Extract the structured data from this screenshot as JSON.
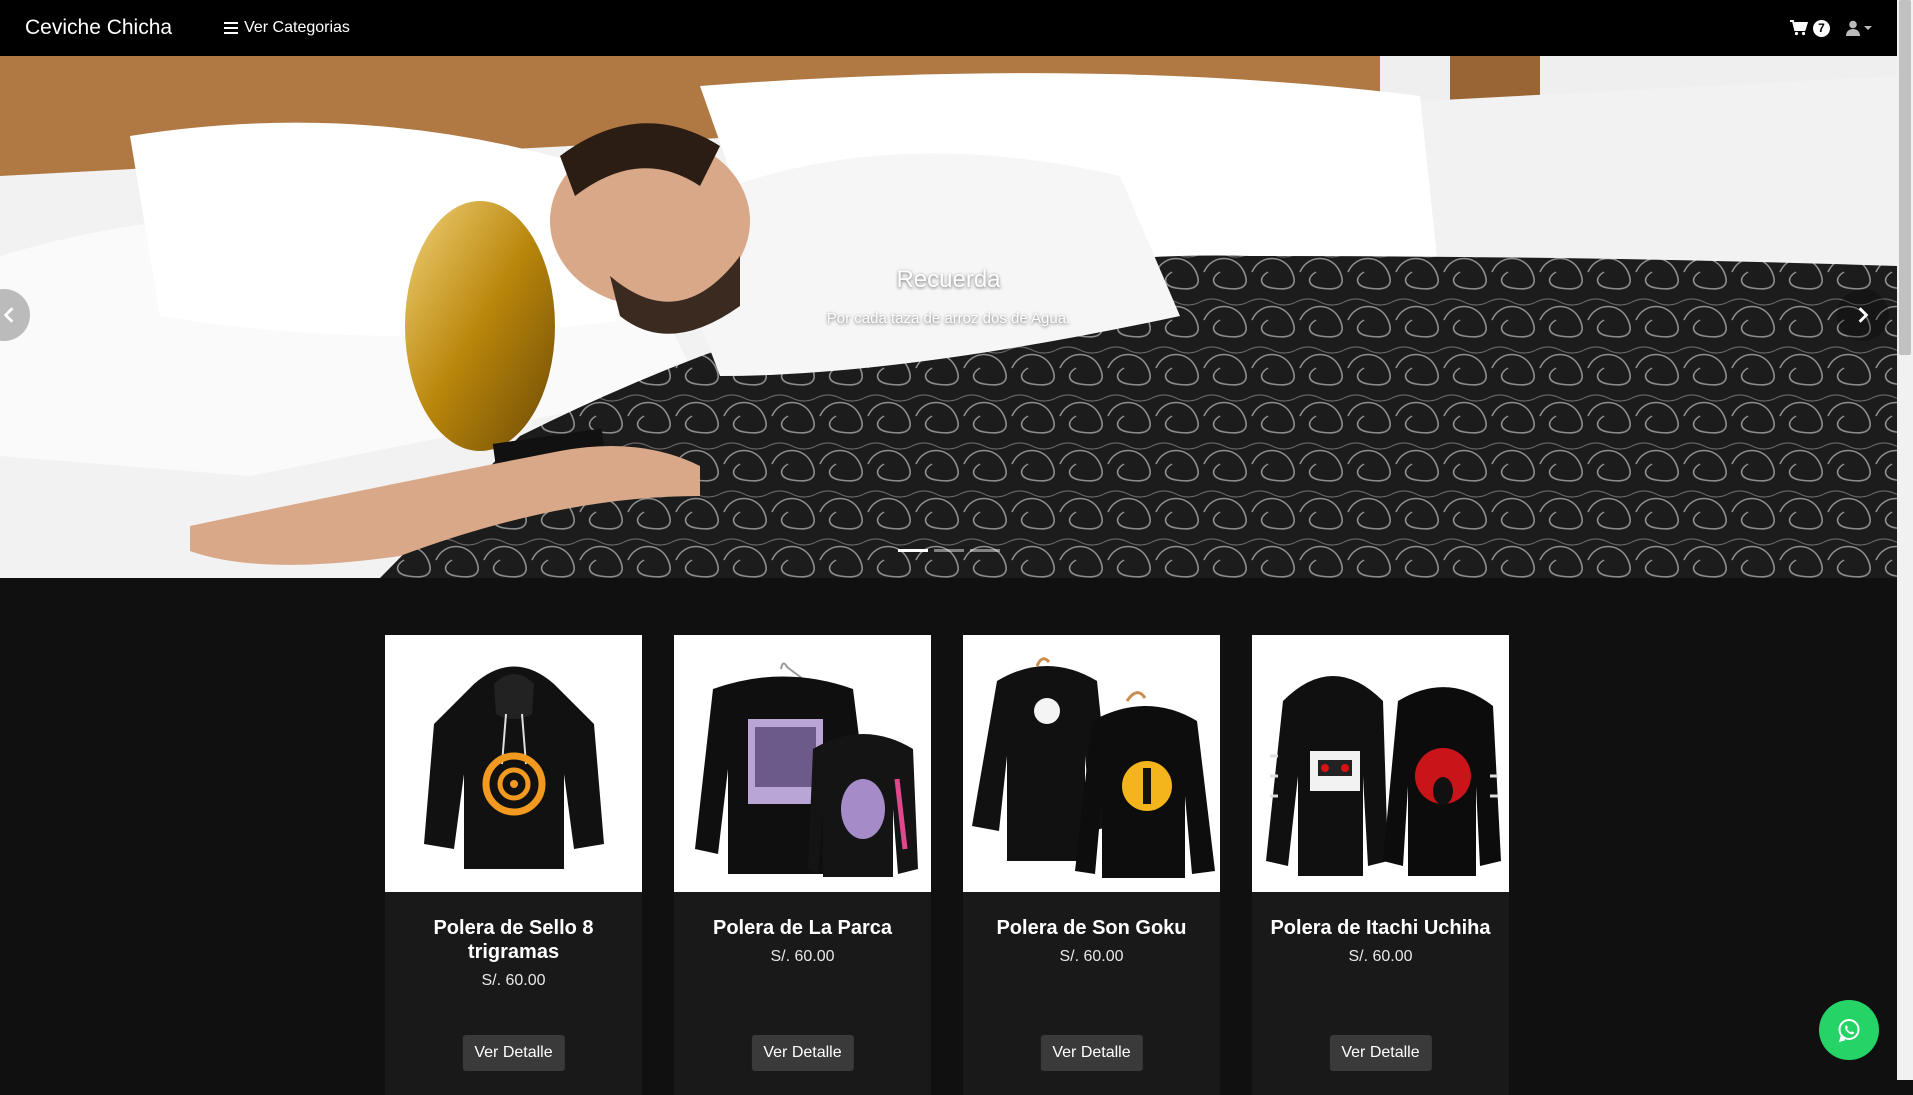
{
  "navbar": {
    "brand": "Ceviche Chicha",
    "categories_label": "Ver Categorias",
    "cart_count": "7",
    "icons": [
      "menu-icon",
      "cart-icon",
      "user-icon"
    ]
  },
  "carousel": {
    "title": "Recuerda",
    "text": "Por cada taza de arroz dos de Agua.",
    "slides_count": 3,
    "active_slide": 1
  },
  "products": [
    {
      "name": "Polera de Sello 8 trigramas",
      "price": "S/. 60.00",
      "button": "Ver Detalle"
    },
    {
      "name": "Polera de La Parca",
      "price": "S/. 60.00",
      "button": "Ver Detalle"
    },
    {
      "name": "Polera de Son Goku",
      "price": "S/. 60.00",
      "button": "Ver Detalle"
    },
    {
      "name": "Polera de Itachi Uchiha",
      "price": "S/. 60.00",
      "button": "Ver Detalle"
    }
  ],
  "colors": {
    "navbar": "#000000",
    "page_background": "#101010",
    "card_background": "#191919",
    "button_background": "#3a3a3a",
    "whatsapp": "#25d366"
  }
}
